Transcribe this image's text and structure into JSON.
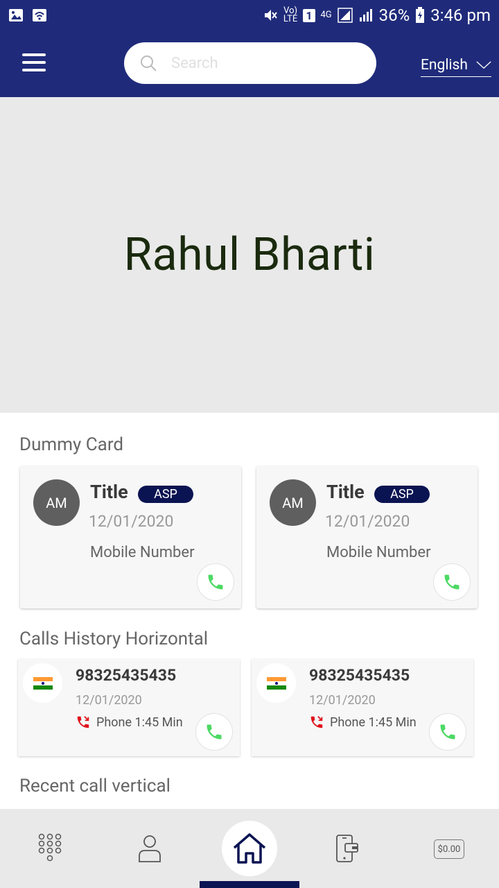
{
  "status_bar": {
    "battery": "36%",
    "time": "3:46 pm",
    "volte": "Vo)\nLTE",
    "sim": "1",
    "network": "4G"
  },
  "header": {
    "search_placeholder": "Search",
    "language": "English"
  },
  "hero": {
    "name": "Rahul Bharti"
  },
  "dummy_section": {
    "title": "Dummy Card",
    "cards": [
      {
        "initials": "AM",
        "title": "Title",
        "badge": "ASP",
        "date": "12/01/2020",
        "mobile": "Mobile Number"
      },
      {
        "initials": "AM",
        "title": "Title",
        "badge": "ASP",
        "date": "12/01/2020",
        "mobile": "Mobile Number"
      }
    ]
  },
  "history_section": {
    "title": "Calls History Horizontal",
    "items": [
      {
        "number": "98325435435",
        "date": "12/01/2020",
        "call_info": "Phone 1:45 Min"
      },
      {
        "number": "98325435435",
        "date": "12/01/2020",
        "call_info": "Phone 1:45 Min"
      }
    ]
  },
  "recent_section": {
    "title": "Recent call vertical"
  },
  "bottom_nav": {
    "wallet_amount": "$0.00",
    "items": [
      "dialpad-icon",
      "contact-icon",
      "home-icon",
      "recharge-icon",
      "wallet-icon"
    ]
  },
  "colors": {
    "primary": "#1f2b7a",
    "badge": "#0b1452",
    "call_green": "#4cd964",
    "missed_red": "#e0121b"
  }
}
